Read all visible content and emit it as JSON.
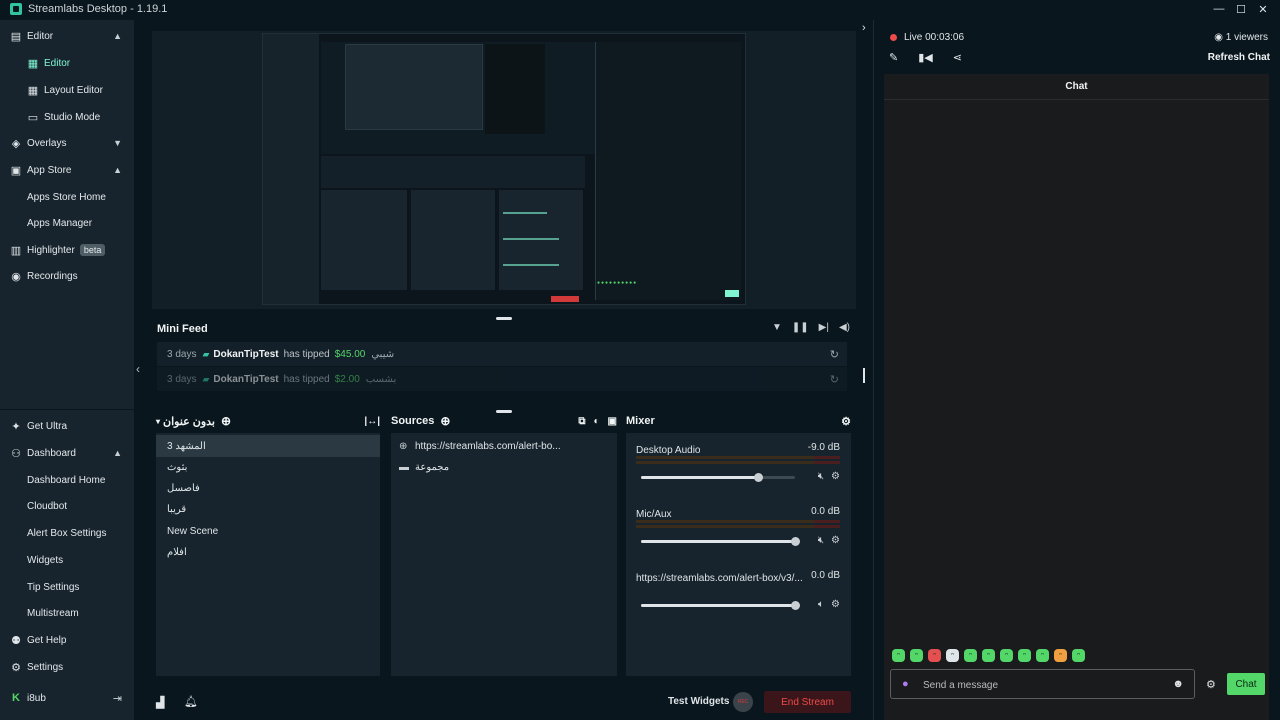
{
  "window": {
    "title": "Streamlabs Desktop - 1.19.1",
    "controls": {
      "minimize": "—",
      "maximize": "☐",
      "close": "✕"
    }
  },
  "sidebar": {
    "editor_group": "Editor",
    "editor_sub": [
      "Editor",
      "Layout Editor",
      "Studio Mode"
    ],
    "overlays": "Overlays",
    "app_store": "App Store",
    "app_store_sub": [
      "Apps Store Home",
      "Apps Manager"
    ],
    "highlighter": "Highlighter",
    "beta": "beta",
    "recordings": "Recordings",
    "get_ultra": "Get Ultra",
    "dashboard": "Dashboard",
    "dashboard_sub": [
      "Dashboard Home",
      "Cloudbot",
      "Alert Box Settings",
      "Widgets",
      "Tip Settings",
      "Multistream"
    ],
    "get_help": "Get Help",
    "settings": "Settings",
    "user": "i8ub"
  },
  "minifeed": {
    "title": "Mini Feed",
    "rows": [
      {
        "ago": "3 days",
        "name": "DokanTipTest",
        "action": "has tipped",
        "amount": "$45.00",
        "message": "شيبي"
      },
      {
        "ago": "3 days",
        "name": "DokanTipTest",
        "action": "has tipped",
        "amount": "$2.00",
        "message": "بشسب"
      }
    ]
  },
  "scenes": {
    "collection": "بدون عنوان",
    "items": [
      "المشهد 3",
      "بثوث",
      "فاصسل",
      "قريبا",
      "New Scene",
      "افلام"
    ]
  },
  "sources": {
    "title": "Sources",
    "items": [
      "https://streamlabs.com/alert-bo...",
      "مجموعة"
    ]
  },
  "mixer": {
    "title": "Mixer",
    "channels": [
      {
        "name": "Desktop Audio",
        "db": "-9.0 dB",
        "level": 0.76
      },
      {
        "name": "Mic/Aux",
        "db": "0.0 dB",
        "level": 1.0
      },
      {
        "name": "https://streamlabs.com/alert-box/v3/...",
        "db": "0.0 dB",
        "level": 1.0
      }
    ]
  },
  "bottombar": {
    "test_widgets": "Test Widgets",
    "rec": "REC",
    "end_stream": "End Stream"
  },
  "chat": {
    "live": "Live 00:03:06",
    "viewers": "1 viewers",
    "refresh": "Refresh Chat",
    "header": "Chat",
    "placeholder": "Send a message",
    "send": "Chat"
  },
  "colors": {
    "accent": "#80f5d2",
    "live": "#ef4a4a",
    "chat_button": "#53d769"
  }
}
